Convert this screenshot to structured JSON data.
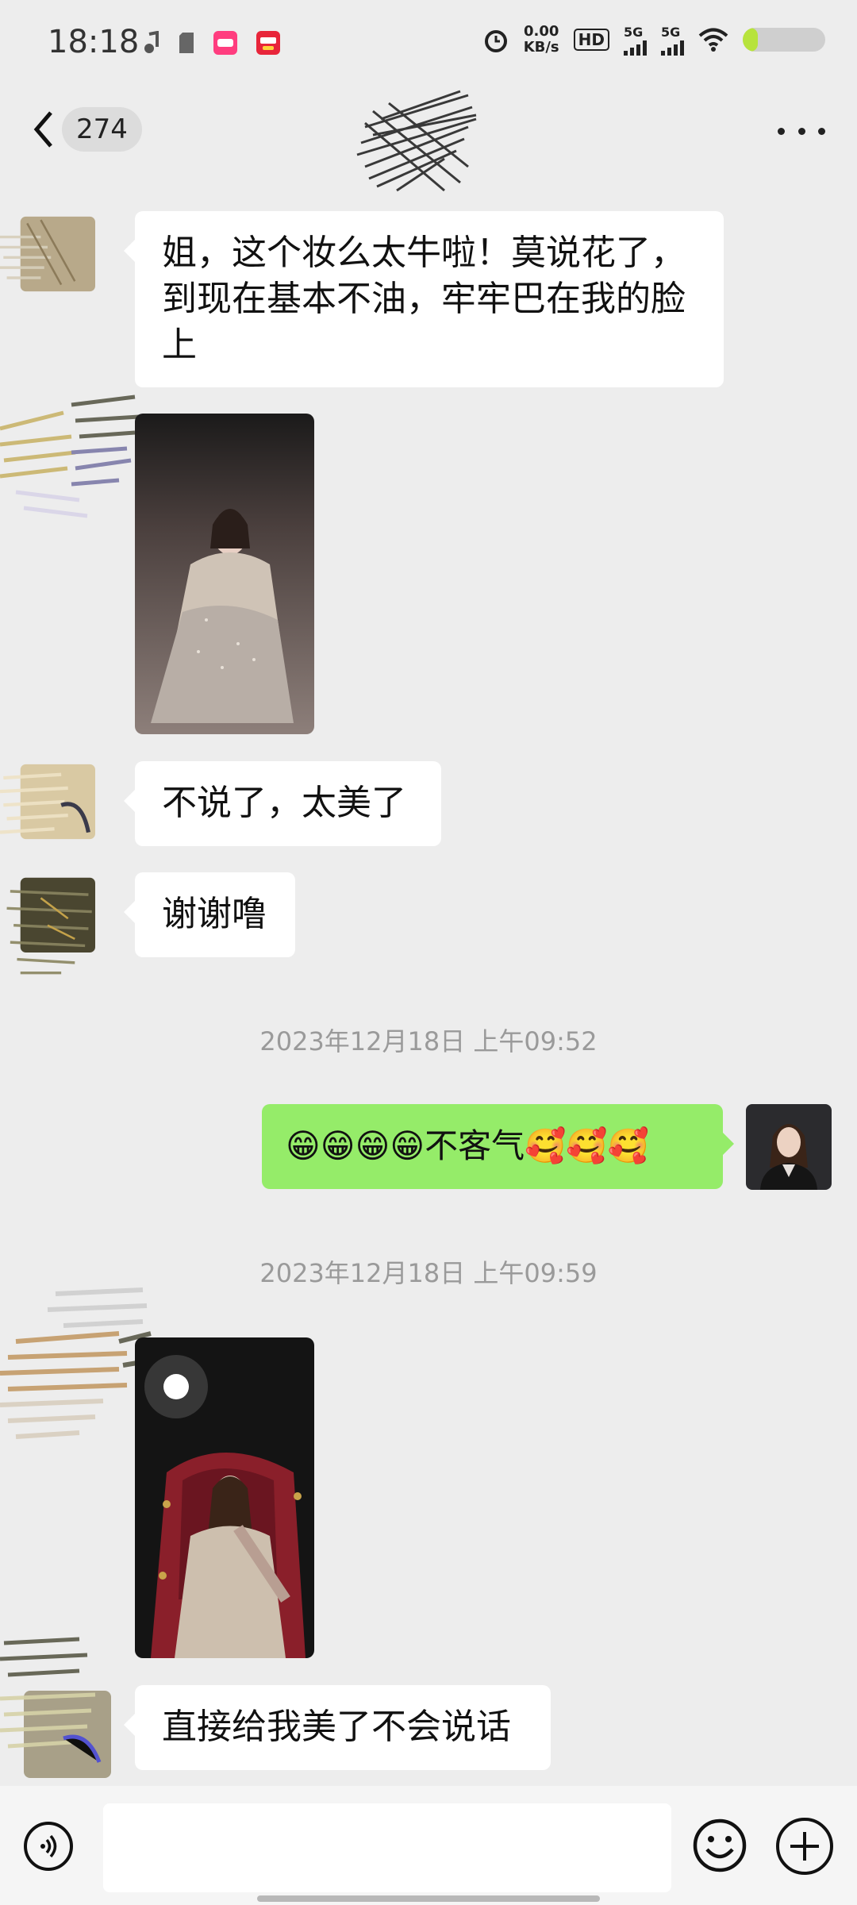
{
  "status_bar": {
    "time": "18:18",
    "net_speed_value": "0.00",
    "net_speed_unit": "KB/s",
    "hd_label": "HD",
    "signal1": "5G",
    "signal2": "5G"
  },
  "header": {
    "unread_count": "274"
  },
  "messages": [
    {
      "side": "left",
      "type": "text",
      "text": "姐，这个妆么太牛啦！莫说花了，到现在基本不油，牢牢巴在我的脸上"
    },
    {
      "side": "left",
      "type": "image",
      "alt": "photo-1"
    },
    {
      "side": "left",
      "type": "text",
      "text": "不说了，太美了"
    },
    {
      "side": "left",
      "type": "text",
      "text": "谢谢噜"
    },
    {
      "type": "timestamp",
      "text": "2023年12月18日 上午09:52"
    },
    {
      "side": "right",
      "type": "text",
      "text": "😁😁😁😁不客气🥰🥰🥰"
    },
    {
      "type": "timestamp",
      "text": "2023年12月18日 上午09:59"
    },
    {
      "side": "left",
      "type": "image",
      "alt": "photo-2"
    },
    {
      "side": "left",
      "type": "text",
      "text": "直接给我美了不会说话"
    }
  ],
  "input_bar": {
    "placeholder": ""
  },
  "colors": {
    "background": "#ededed",
    "incoming_bubble": "#ffffff",
    "outgoing_bubble": "#95ec69",
    "timestamp": "#9a9a9a"
  }
}
